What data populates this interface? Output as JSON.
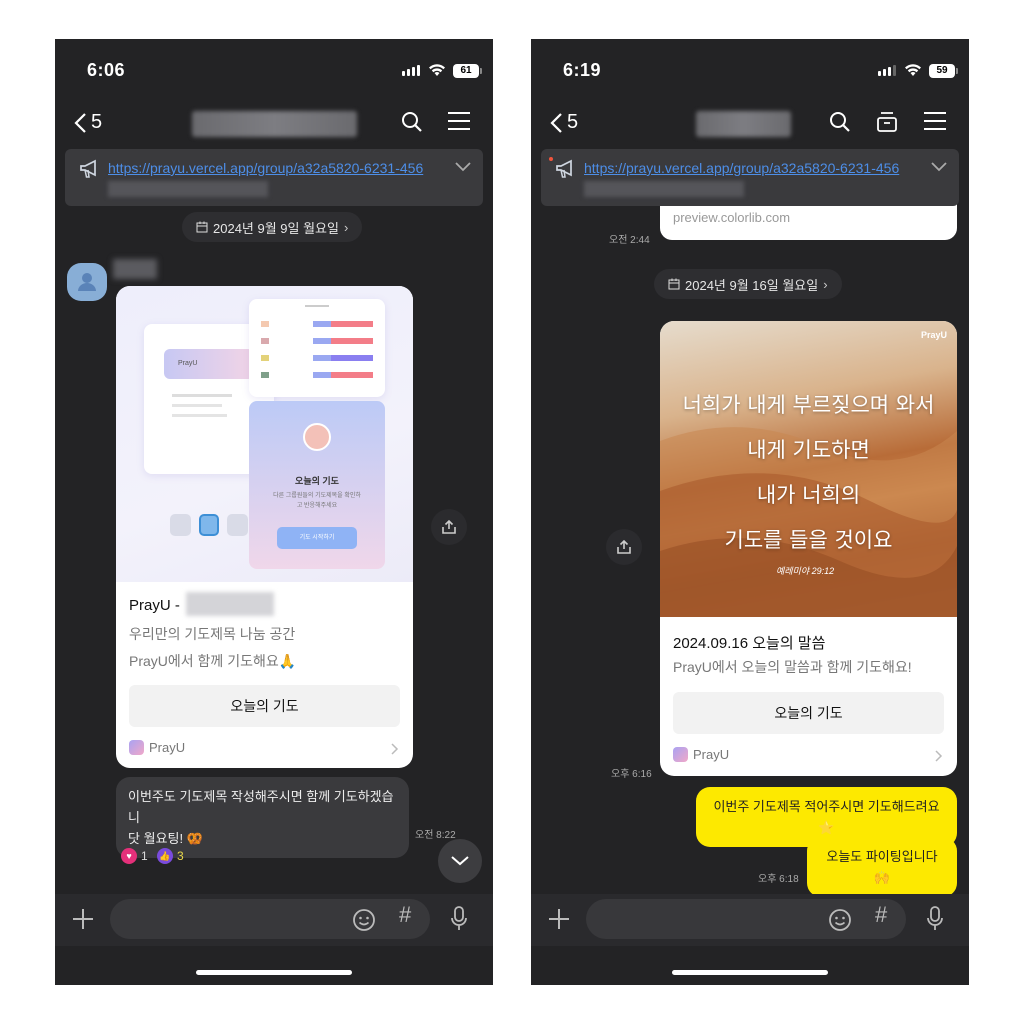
{
  "left": {
    "status": {
      "time": "6:06",
      "battery": "61"
    },
    "nav": {
      "back_count": "5"
    },
    "notice": {
      "link": "https://prayu.vercel.app/group/a32a5820-6231-456"
    },
    "date_chip": "2024년 9월 9일 월요일",
    "card": {
      "preview_brand": "PrayU",
      "preview_panel_title": "오늘의 기도",
      "preview_panel_text": "다른 그룹원들의 기도제목을 확인하고 반응해주세요",
      "preview_button": "기도 시작하기",
      "title": "PrayU -",
      "desc_line1": "우리만의 기도제목 나눔 공간",
      "desc_line2": "PrayU에서 함께 기도해요🙏",
      "cta": "오늘의 기도",
      "brand": "PrayU"
    },
    "message": {
      "text_line1": "이번주도 기도제목 작성해주시면 함께 기도하겠습니",
      "text_line2": "닷 월요팅! 🥨",
      "time": "오전 8:22"
    },
    "reactions": {
      "heart_count": "1",
      "like_count": "3"
    }
  },
  "right": {
    "status": {
      "time": "6:19",
      "battery": "59"
    },
    "nav": {
      "back_count": "5"
    },
    "notice": {
      "link": "https://prayu.vercel.app/group/a32a5820-6231-456"
    },
    "prev_card_url": "preview.colorlib.com",
    "prev_time": "오전 2:44",
    "date_chip": "2024년 9월 16일 월요일",
    "card": {
      "image_brand": "PrayU",
      "verse_line1": "너희가 내게 부르짖으며 와서",
      "verse_line2": "내게 기도하면",
      "verse_line3": "내가 너희의",
      "verse_line4": "기도를 들을 것이요",
      "verse_ref": "예레미야 29:12",
      "title": "2024.09.16 오늘의 말씀",
      "desc": "PrayU에서 오늘의 말씀과 함께 기도해요!",
      "cta": "오늘의 기도",
      "brand": "PrayU",
      "time": "오후 6:16"
    },
    "sent1": "이번주 기도제목 적어주시면 기도해드려요⭐",
    "sent2": "오늘도 파이팅입니다🙌",
    "sent_time": "오후 6:18"
  },
  "colors": {
    "background": "#232325",
    "accent_yellow": "#fde900",
    "link": "#4d8ee8"
  }
}
